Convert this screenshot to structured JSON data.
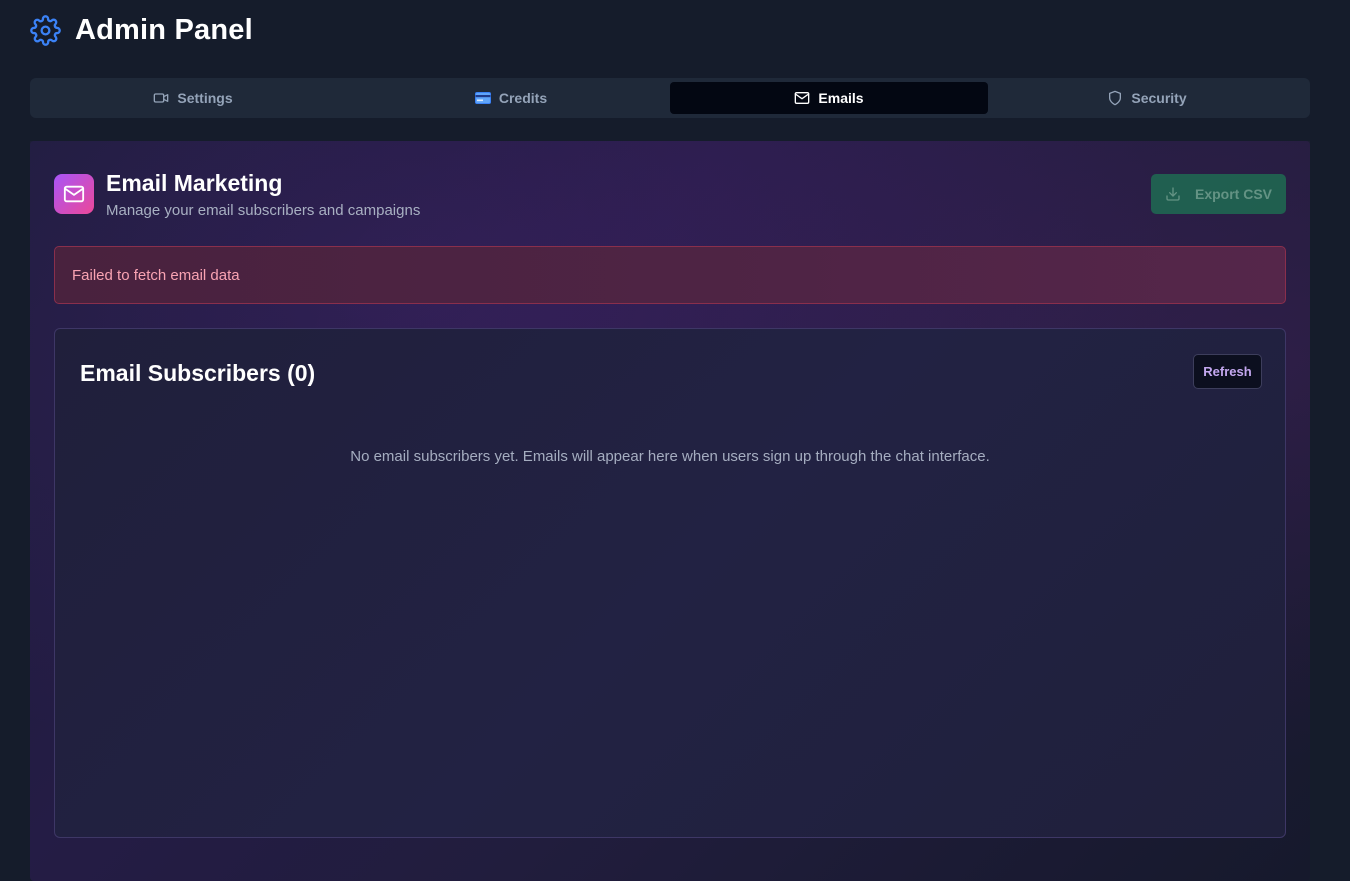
{
  "header": {
    "title": "Admin Panel",
    "icon": "gear-icon"
  },
  "tabs": [
    {
      "label": "Settings",
      "icon": "video-camera-icon",
      "active": false
    },
    {
      "label": "Credits",
      "icon": "credit-card-icon",
      "active": false
    },
    {
      "label": "Emails",
      "icon": "envelope-icon",
      "active": true
    },
    {
      "label": "Security",
      "icon": "shield-icon",
      "active": false
    }
  ],
  "email_marketing": {
    "title": "Email Marketing",
    "subtitle": "Manage your email subscribers and campaigns",
    "icon": "envelope-icon",
    "export_label": "Export CSV",
    "export_icon": "download-icon"
  },
  "error": {
    "message": "Failed to fetch email data"
  },
  "subscribers": {
    "title": "Email Subscribers (0)",
    "refresh_label": "Refresh",
    "empty_message": "No email subscribers yet. Emails will appear here when users sign up through the chat interface."
  },
  "colors": {
    "accent": "#a855f7",
    "export_button": "#1f6b52",
    "error_text": "#f9a3b3",
    "active_tab": "#030712"
  }
}
